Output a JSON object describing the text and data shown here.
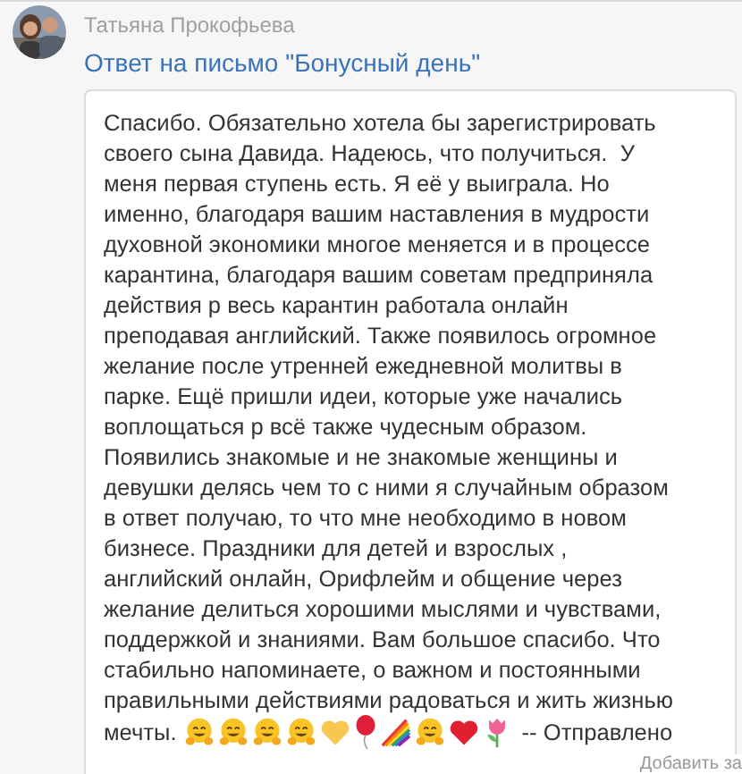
{
  "message": {
    "sender": "Татьяна Прокофьева",
    "subject": "Ответ на письмо \"Бонусный день\"",
    "body_lines": [
      "Спасибо. Обязательно хотела бы зарегистрировать",
      "своего сына Давида. Надеюсь, что получиться.  У",
      "меня первая ступень есть. Я её у выиграла. Но",
      "именно, благодаря вашим наставления в мудрости",
      "духовной экономики многое меняется и в процессе",
      "карантина, благодаря вашим советам предприняла",
      "действия р весь карантин работала онлайн",
      "преподавая английский. Также появилось огромное",
      "желание после утренней ежедневной молитвы в",
      "парке. Ещё пришли идеи, которые уже начались",
      "воплощаться р всё также чудесным образом.",
      "Появились знакомые и не знакомые женщины и",
      "девушки делясь чем то с ними я случайным образом",
      "в ответ получаю, то что мне необходимо в новом",
      "бизнесе. Праздники для детей и взрослых ,",
      "английский онлайн, Орифлейм и общение через",
      "желание делиться хорошими мыслями и чувствами,",
      "поддержкой и знаниями. Вам большое спасибо. Что",
      "стабильно напоминаете, о важном и постоянными",
      "правильными действиями радоваться и жить жизнью",
      "мечты."
    ],
    "signature": "-- Отправлено"
  },
  "overlay_link": "Добавить за"
}
